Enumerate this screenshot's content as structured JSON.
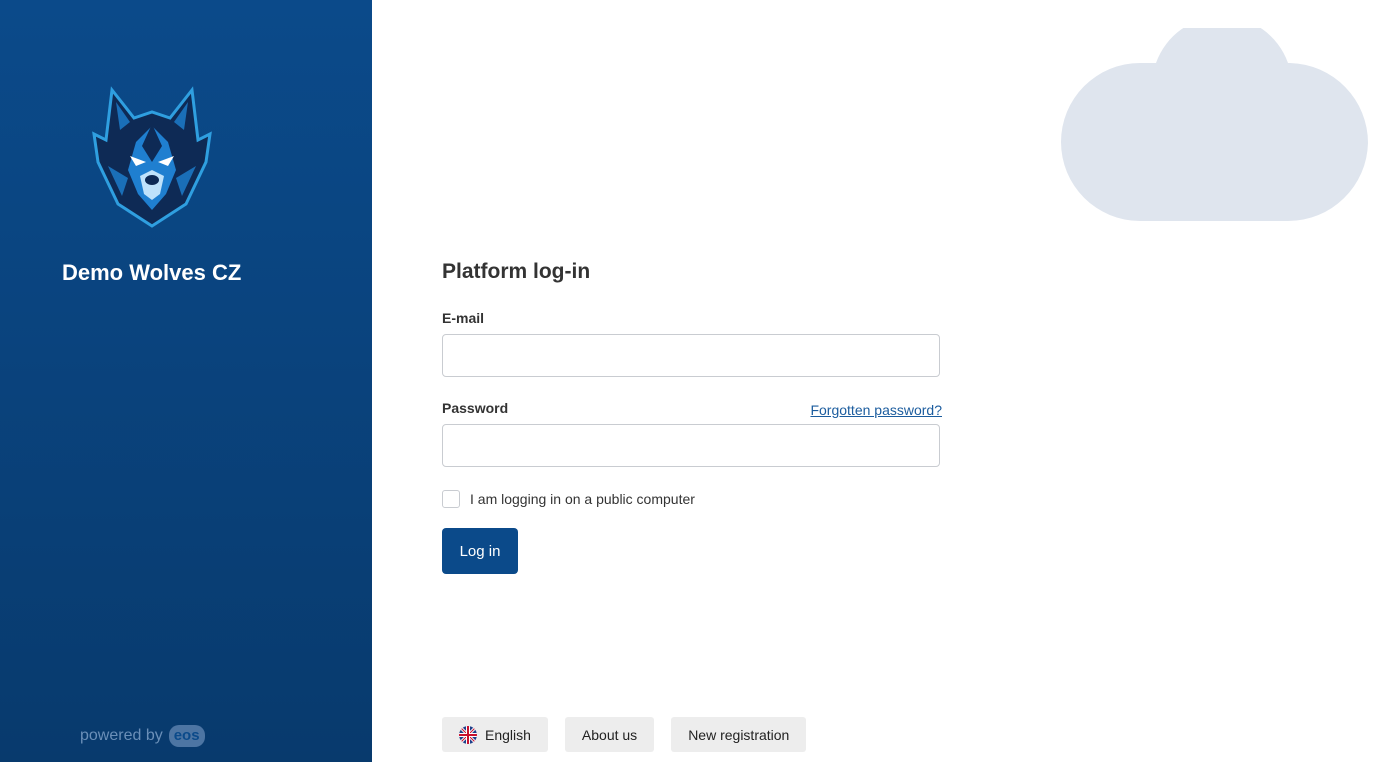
{
  "sidebar": {
    "club_name": "Demo Wolves CZ",
    "logo_icon": "wolf-logo-icon",
    "powered_by_text": "powered by",
    "powered_by_brand": "eos"
  },
  "login": {
    "title": "Platform log-in",
    "email_label": "E-mail",
    "email_value": "",
    "password_label": "Password",
    "password_value": "",
    "forgot_password": "Forgotten password?",
    "public_computer_label": "I am logging in on a public computer",
    "public_computer_checked": false,
    "submit_label": "Log in"
  },
  "footer": {
    "language_label": "English",
    "language_icon": "uk-flag-icon",
    "about_label": "About us",
    "register_label": "New registration"
  },
  "colors": {
    "primary": "#0b4a8a",
    "cloud": "#dfe5ee",
    "link": "#1b5c9e",
    "footer_button_bg": "#ededed"
  }
}
